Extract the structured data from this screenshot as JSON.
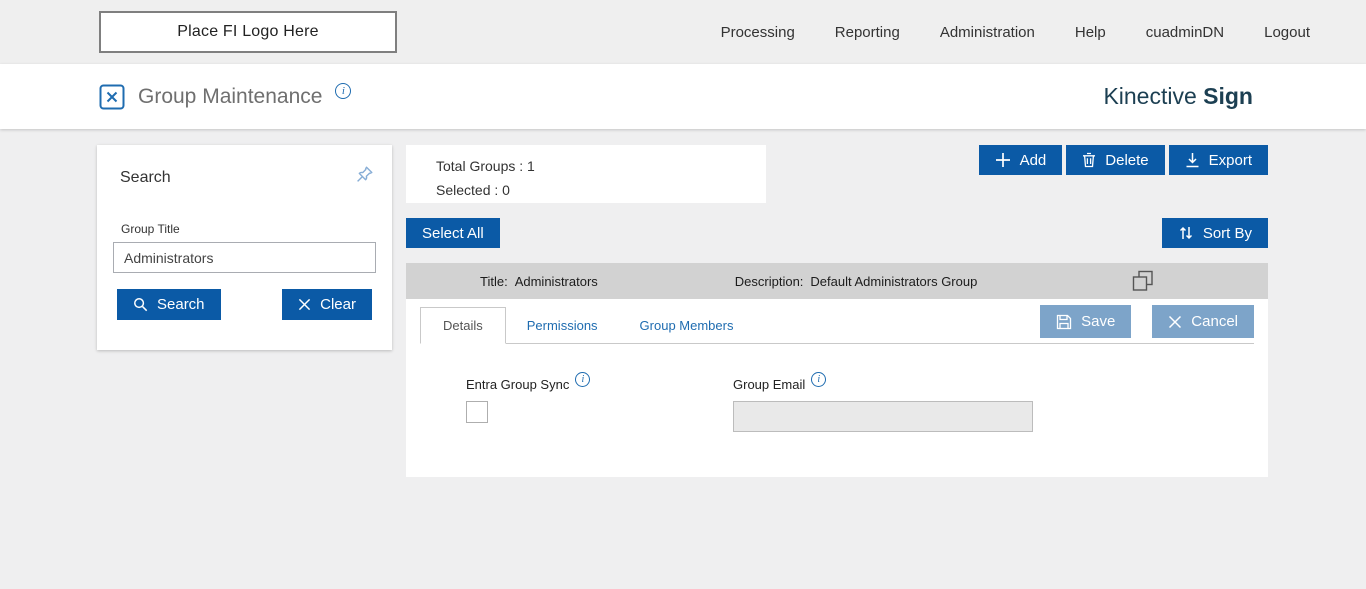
{
  "topbar": {
    "logo_placeholder": "Place FI Logo Here",
    "nav": [
      "Processing",
      "Reporting",
      "Administration",
      "Help",
      "cuadminDN",
      "Logout"
    ]
  },
  "header": {
    "title": "Group Maintenance",
    "brand_regular": "Kinective ",
    "brand_bold": "Sign"
  },
  "search_panel": {
    "title": "Search",
    "group_title_label": "Group Title",
    "group_title_value": "Administrators",
    "search_button": "Search",
    "clear_button": "Clear"
  },
  "summary": {
    "total_groups_label": "Total Groups :",
    "total_groups_value": "1",
    "selected_label": "Selected :",
    "selected_value": "0"
  },
  "toolbar": {
    "add": "Add",
    "delete": "Delete",
    "export": "Export",
    "select_all": "Select All",
    "sort_by": "Sort By"
  },
  "group_row": {
    "title_label": "Title:",
    "title_value": "Administrators",
    "description_label": "Description:",
    "description_value": "Default Administrators Group"
  },
  "detail": {
    "tabs": [
      "Details",
      "Permissions",
      "Group Members"
    ],
    "save_button": "Save",
    "cancel_button": "Cancel",
    "entra_group_sync_label": "Entra Group Sync",
    "group_email_label": "Group Email",
    "group_email_value": ""
  },
  "icons": {
    "app": "tools-box-icon",
    "info": "info-circle-icon",
    "pin": "push-pin-icon",
    "search": "magnifier-icon",
    "clear": "x-icon",
    "add": "plus-icon",
    "delete": "trash-icon",
    "export": "download-icon",
    "sort": "up-down-arrows-icon",
    "copy": "copy-squares-icon",
    "save": "floppy-disk-icon",
    "cancel": "x-icon",
    "info_char": "i"
  },
  "colors": {
    "primary_blue": "#0b5aa6",
    "link_blue": "#1f6cb0",
    "muted_blue": "#7da4c9",
    "brand_navy": "#1c3f52",
    "bar_gray": "#d2d2d2",
    "page_gray": "#efeff0"
  }
}
